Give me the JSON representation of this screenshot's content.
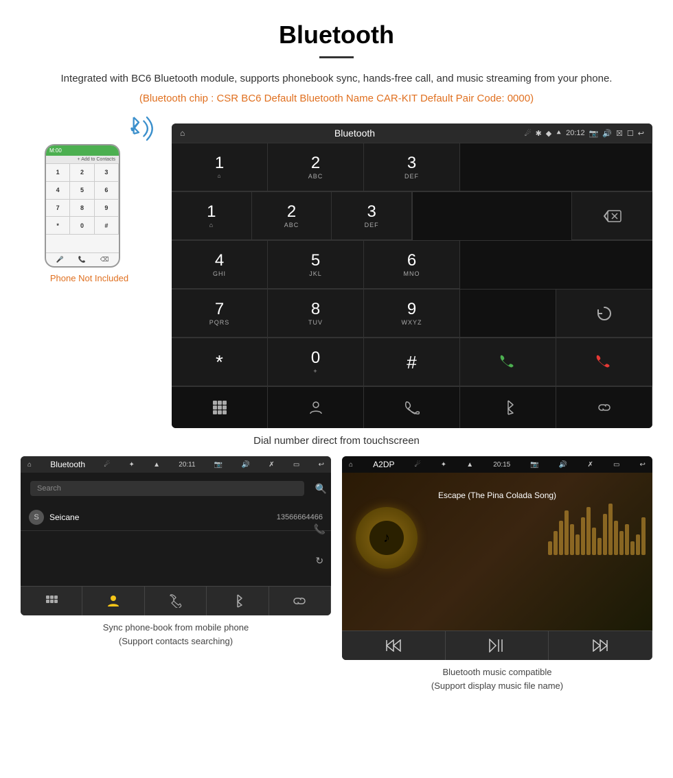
{
  "header": {
    "title": "Bluetooth",
    "description": "Integrated with BC6 Bluetooth module, supports phonebook sync, hands-free call, and music streaming from your phone.",
    "specs": "(Bluetooth chip : CSR BC6    Default Bluetooth Name CAR-KIT    Default Pair Code: 0000)"
  },
  "phone_area": {
    "not_included_label": "Phone Not Included"
  },
  "dial_screen": {
    "status_title": "Bluetooth",
    "time": "20:12",
    "dialpad_keys": [
      {
        "num": "1",
        "sub": ""
      },
      {
        "num": "2",
        "sub": "ABC"
      },
      {
        "num": "3",
        "sub": "DEF"
      },
      {
        "num": "4",
        "sub": "GHI"
      },
      {
        "num": "5",
        "sub": "JKL"
      },
      {
        "num": "6",
        "sub": "MNO"
      },
      {
        "num": "7",
        "sub": "PQRS"
      },
      {
        "num": "8",
        "sub": "TUV"
      },
      {
        "num": "9",
        "sub": "WXYZ"
      },
      {
        "num": "*",
        "sub": ""
      },
      {
        "num": "0",
        "sub": "+"
      },
      {
        "num": "#",
        "sub": ""
      }
    ],
    "caption": "Dial number direct from touchscreen"
  },
  "phonebook_screen": {
    "status_title": "Bluetooth",
    "time": "20:11",
    "search_placeholder": "Search",
    "contact_initial": "S",
    "contact_name": "Seicane",
    "contact_number": "13566664466",
    "caption_line1": "Sync phone-book from mobile phone",
    "caption_line2": "(Support contacts searching)"
  },
  "music_screen": {
    "status_title": "A2DP",
    "time": "20:15",
    "song_title": "Escape (The Pina Colada Song)",
    "caption_line1": "Bluetooth music compatible",
    "caption_line2": "(Support display music file name)"
  }
}
